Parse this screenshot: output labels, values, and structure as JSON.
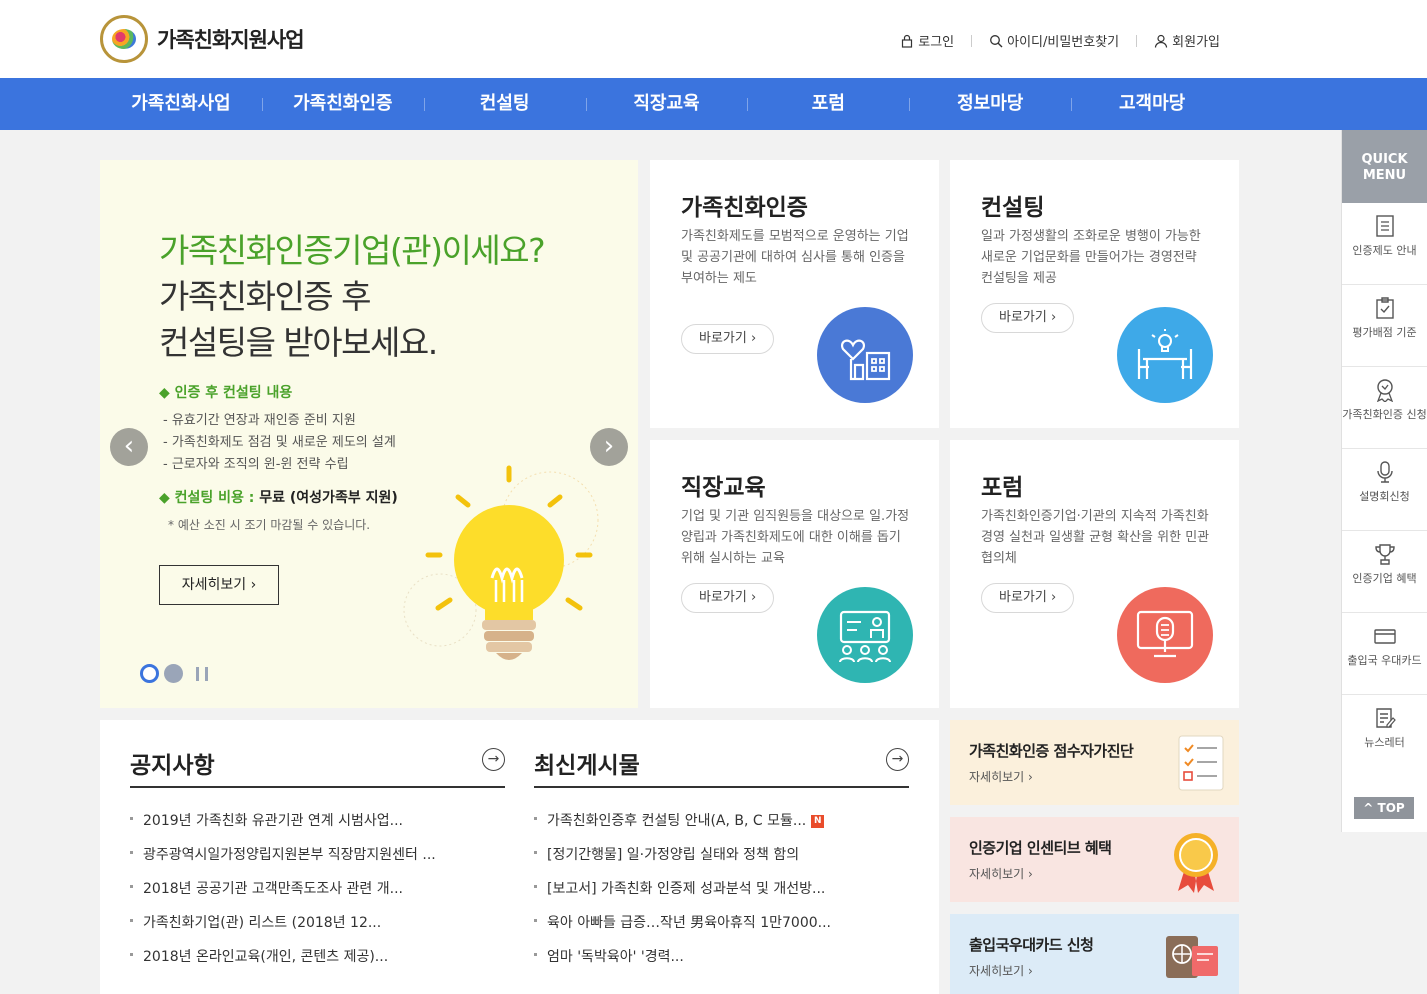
{
  "brand": {
    "name": "가족친화지원사업"
  },
  "util": {
    "login": "로그인",
    "find": "아이디/비밀번호찾기",
    "join": "회원가입"
  },
  "nav": [
    "가족친화사업",
    "가족친화인증",
    "컨설팅",
    "직장교육",
    "포럼",
    "정보마당",
    "고객마당"
  ],
  "hero": {
    "title1": "가족친화인증기업(관)이세요?",
    "title2": "가족친화인증 후",
    "title3": "컨설팅을 받아보세요.",
    "section1": "◆ 인증 후 컨설팅 내용",
    "items": [
      "- 유효기간 연장과 재인증 준비 지원",
      "- 가족친화제도 점검 및 새로운 제도의 설계",
      "- 근로자와 조직의 윈-윈 전략 수립"
    ],
    "cost_label": "◆ 컨설팅 비용 :",
    "cost_value": "무료 (여성가족부 지원)",
    "note": "* 예산 소진 시 조기 마감될 수 있습니다.",
    "more": "자세히보기 ›",
    "prev": "‹",
    "next": "›"
  },
  "cards": [
    {
      "title": "가족친화인증",
      "desc": "가족친화제도를 모범적으로 운영하는 기업 및 공공기관에 대하여 심사를 통해 인증을 부여하는 제도",
      "btn": "바로가기 ›",
      "color": "#4a79d6"
    },
    {
      "title": "컨설팅",
      "desc": "일과 가정생활의 조화로운 병행이 가능한 새로운 기업문화를 만들어가는 경영전략 컨설팅을 제공",
      "btn": "바로가기 ›",
      "color": "#3ea9e8"
    },
    {
      "title": "직장교육",
      "desc": "기업 및 기관 임직원등을 대상으로 일.가정양립과 가족친화제도에 대한 이해를 돕기 위해 실시하는 교육",
      "btn": "바로가기 ›",
      "color": "#2fb5b2"
    },
    {
      "title": "포럼",
      "desc": "가족친화인증기업·기관의 지속적 가족친화경영 실천과 일생활 균형 확산을 위한 민관 협의체",
      "btn": "바로가기 ›",
      "color": "#ef6a5d"
    }
  ],
  "notice": {
    "title": "공지사항",
    "items": [
      "2019년 가족친화 유관기관 연계 시범사업...",
      "광주광역시일가정양립지원본부 직장맘지원센터 ...",
      "2018년 공공기관 고객만족도조사 관련 개...",
      "가족친화기업(관) 리스트 (2018년 12...",
      "2018년 온라인교육(개인, 콘텐츠 제공)..."
    ]
  },
  "latest": {
    "title": "최신게시물",
    "items": [
      "가족친화인증후 컨설팅 안내(A, B, C 모듈...",
      "[정기간행물] 일·가정양립 실태와 정책 함의",
      "[보고서] 가족친화 인증제 성과분석 및 개선방...",
      "육아 아빠들 급증…작년 男육아휴직 1만7000...",
      "엄마 '독박육아' '경력..."
    ],
    "new_badge": "N"
  },
  "banners": [
    {
      "title": "가족친화인증 점수자가진단",
      "link": "자세히보기 ›",
      "bg": "#fbf0dc"
    },
    {
      "title": "인증기업 인센티브 혜택",
      "link": "자세히보기 ›",
      "bg": "#f9e5e1"
    },
    {
      "title": "출입국우대카드 신청",
      "link": "자세히보기 ›",
      "bg": "#dcebf7"
    }
  ],
  "quick": {
    "head": "QUICK MENU",
    "items": [
      {
        "label": "인증제도 안내",
        "icon": "document-icon"
      },
      {
        "label": "평가배점 기준",
        "icon": "clipboard-check-icon"
      },
      {
        "label": "가족친화인증 신청",
        "icon": "award-icon"
      },
      {
        "label": "설명회신청",
        "icon": "microphone-icon"
      },
      {
        "label": "인증기업 혜택",
        "icon": "trophy-icon"
      },
      {
        "label": "출입국 우대카드",
        "icon": "card-icon"
      },
      {
        "label": "뉴스레터",
        "icon": "newsletter-icon"
      }
    ],
    "top": "TOP"
  }
}
